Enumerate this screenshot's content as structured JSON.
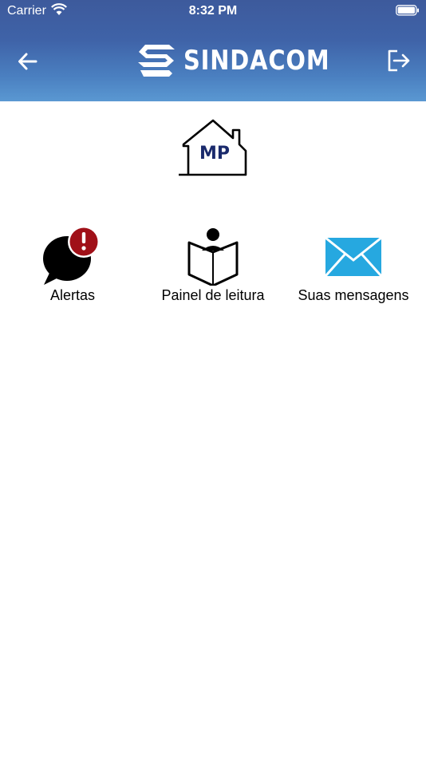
{
  "status_bar": {
    "carrier": "Carrier",
    "time": "8:32 PM"
  },
  "header": {
    "brand": "SINDACOM"
  },
  "house_logo": {
    "text": "MP"
  },
  "menu": [
    {
      "label": "Alertas",
      "icon": "alert-chat-icon"
    },
    {
      "label": "Painel de leitura",
      "icon": "reader-book-icon"
    },
    {
      "label": "Suas mensagens",
      "icon": "envelope-icon"
    }
  ],
  "colors": {
    "header_top": "#3d5a9c",
    "header_bottom": "#5a98d2",
    "alert_red": "#a01018",
    "envelope_blue": "#26a8e0",
    "house_text": "#1a2a6c"
  }
}
